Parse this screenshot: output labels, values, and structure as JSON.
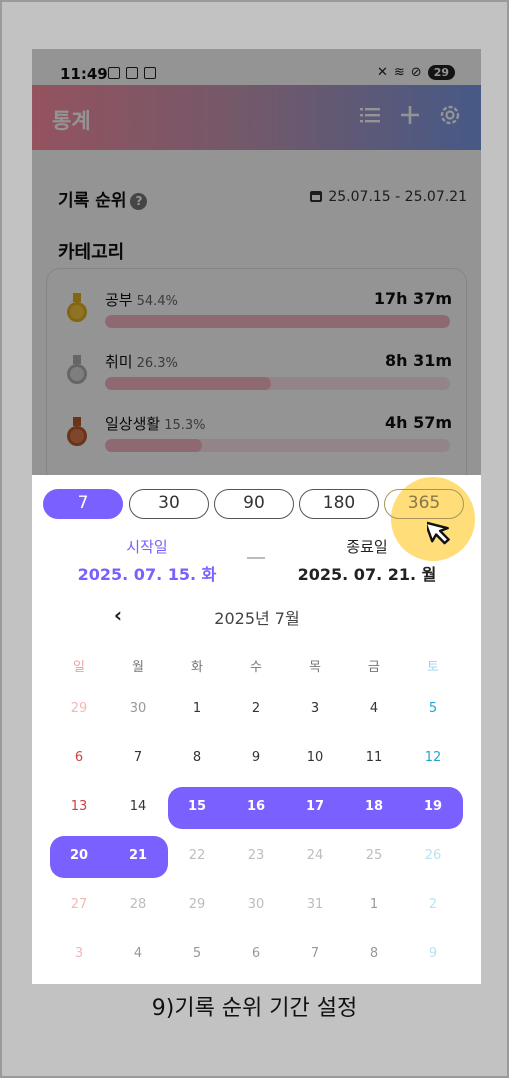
{
  "status_bar": {
    "time": "11:49",
    "battery": "29"
  },
  "header": {
    "title": "통계"
  },
  "ranking": {
    "title": "기록 순위",
    "help": "?",
    "date_range": "25.07.15 - 25.07.21",
    "category_title": "카테고리",
    "items": [
      {
        "name": "공부",
        "pct": "54.4%",
        "time": "17h 37m",
        "fill": 1.0,
        "medal": "gold"
      },
      {
        "name": "취미",
        "pct": "26.3%",
        "time": "8h 31m",
        "fill": 0.48,
        "medal": "silver"
      },
      {
        "name": "일상생활",
        "pct": "15.3%",
        "time": "4h 57m",
        "fill": 0.28,
        "medal": "bronze"
      }
    ]
  },
  "period_chips": [
    "7",
    "30",
    "90",
    "180",
    "365"
  ],
  "active_chip": "7",
  "start": {
    "label": "시작일",
    "value": "2025. 07. 15. 화"
  },
  "end": {
    "label": "종료일",
    "value": "2025. 07. 21. 월"
  },
  "calendar": {
    "prev": "‹",
    "month_title": "2025년 7월",
    "weekdays": [
      "일",
      "월",
      "화",
      "수",
      "목",
      "금",
      "토"
    ],
    "weeks": [
      [
        "29",
        "30",
        "1",
        "2",
        "3",
        "4",
        "5"
      ],
      [
        "6",
        "7",
        "8",
        "9",
        "10",
        "11",
        "12"
      ],
      [
        "13",
        "14",
        "15",
        "16",
        "17",
        "18",
        "19"
      ],
      [
        "20",
        "21",
        "22",
        "23",
        "24",
        "25",
        "26"
      ],
      [
        "27",
        "28",
        "29",
        "30",
        "31",
        "1",
        "2"
      ],
      [
        "3",
        "4",
        "5",
        "6",
        "7",
        "8",
        "9"
      ]
    ]
  },
  "caption": "9)기록 순위 기간 설정",
  "colors": {
    "accent": "#7a61ff",
    "highlight": "#ffd65a"
  }
}
